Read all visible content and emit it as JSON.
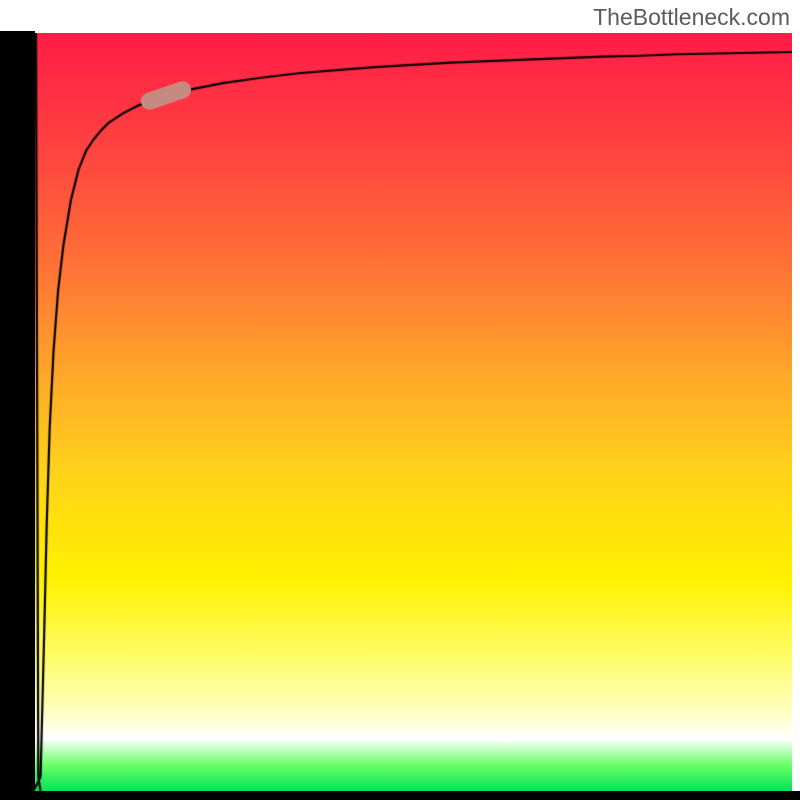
{
  "attribution": "TheBottleneck.com",
  "chart_data": {
    "type": "line",
    "title": "",
    "xlabel": "",
    "ylabel": "",
    "x": [
      0.0,
      0.01,
      0.012,
      0.015,
      0.018,
      0.022,
      0.027,
      0.033,
      0.04,
      0.05,
      0.06,
      0.07,
      0.08,
      0.09,
      0.1,
      0.12,
      0.14,
      0.16,
      0.18,
      0.2,
      0.25,
      0.3,
      0.35,
      0.4,
      0.45,
      0.5,
      0.55,
      0.6,
      0.65,
      0.7,
      0.75,
      0.8,
      0.85,
      0.9,
      0.95,
      1.0
    ],
    "values": [
      0.0,
      0.02,
      0.1,
      0.22,
      0.35,
      0.48,
      0.58,
      0.66,
      0.72,
      0.78,
      0.82,
      0.845,
      0.86,
      0.872,
      0.882,
      0.895,
      0.905,
      0.913,
      0.919,
      0.924,
      0.934,
      0.941,
      0.947,
      0.951,
      0.955,
      0.958,
      0.961,
      0.963,
      0.965,
      0.967,
      0.969,
      0.97,
      0.972,
      0.973,
      0.974,
      0.975
    ],
    "xlim": [
      0,
      1
    ],
    "ylim": [
      0,
      1
    ],
    "grid": false,
    "initial_dip": {
      "x": [
        0.004,
        0.007,
        0.01
      ],
      "values": [
        1.0,
        0.02,
        0.0
      ]
    },
    "marker": {
      "x": 0.175,
      "y": 0.917,
      "angle_deg": -19
    },
    "colors": {
      "line": "#000000",
      "marker": "#c58a80"
    }
  }
}
